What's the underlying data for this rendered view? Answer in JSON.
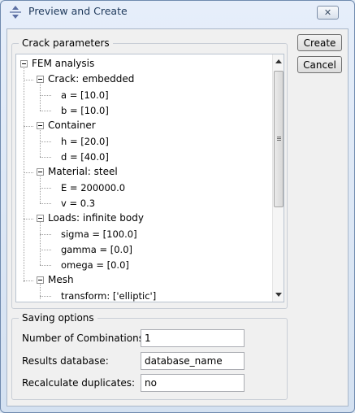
{
  "window": {
    "title": "Preview and Create"
  },
  "buttons": {
    "create": "Create",
    "cancel": "Cancel"
  },
  "crack_group": {
    "legend": "Crack parameters"
  },
  "tree": {
    "root": "FEM analysis",
    "crack": {
      "label": "Crack: embedded",
      "leaves": [
        "a = [10.0]",
        "b = [10.0]"
      ]
    },
    "container": {
      "label": "Container",
      "leaves": [
        "h = [20.0]",
        "d = [40.0]"
      ]
    },
    "material": {
      "label": "Material: steel",
      "leaves": [
        "E = 200000.0",
        "v = 0.3"
      ]
    },
    "loads": {
      "label": "Loads: infinite body",
      "leaves": [
        "sigma = [100.0]",
        "gamma = [0.0]",
        "omega = [0.0]"
      ]
    },
    "mesh": {
      "label": "Mesh",
      "leaves": [
        "transform: ['elliptic']"
      ]
    }
  },
  "saving": {
    "legend": "Saving options",
    "fields": [
      {
        "label": "Number of Combinations:",
        "value": "1"
      },
      {
        "label": "Results database:",
        "value": "database_name"
      },
      {
        "label": "Recalculate duplicates:",
        "value": "no"
      }
    ]
  }
}
